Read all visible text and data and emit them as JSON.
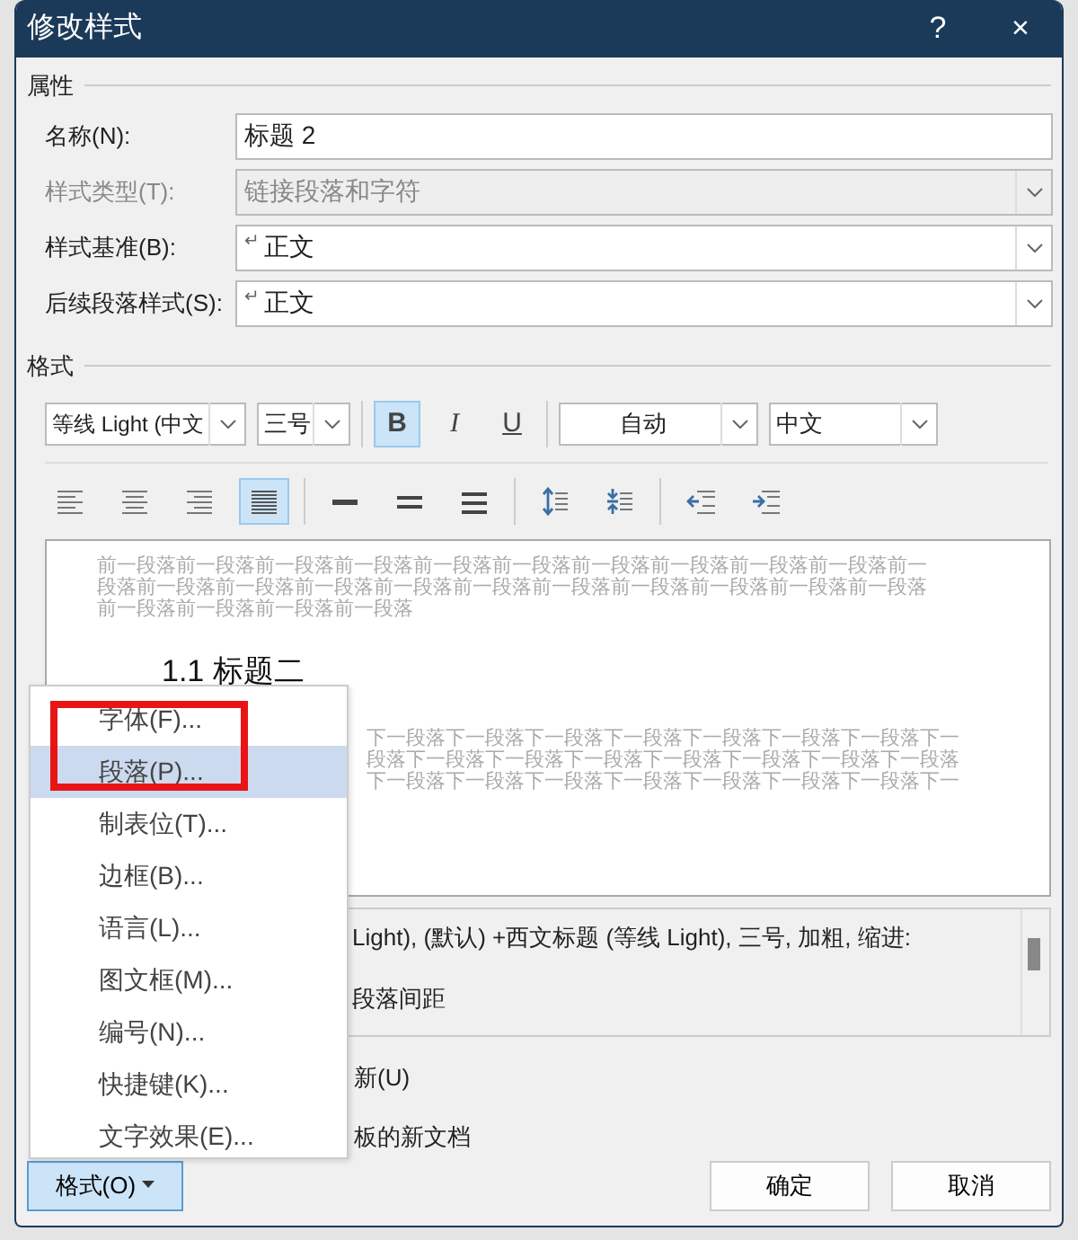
{
  "window": {
    "title": "修改样式",
    "help": "?",
    "close": "×"
  },
  "properties": {
    "heading": "属性",
    "fields": [
      {
        "label": "名称(N):",
        "kind": "text",
        "value": "标题 2",
        "disabled": false
      },
      {
        "label": "样式类型(T):",
        "kind": "combo",
        "value": "链接段落和字符",
        "disabled": true
      },
      {
        "label": "样式基准(B):",
        "kind": "combo",
        "value": "正文",
        "mark": "↵",
        "disabled": false
      },
      {
        "label": "后续段落样式(S):",
        "kind": "combo",
        "value": "正文",
        "mark": "↵",
        "disabled": false
      }
    ]
  },
  "format": {
    "heading": "格式",
    "font": "等线 Light (中文",
    "size": "三号",
    "styles": [
      {
        "kind": "bold",
        "label": "B",
        "selected": true
      },
      {
        "kind": "italic",
        "label": "I",
        "selected": false
      },
      {
        "kind": "underline",
        "label": "U",
        "selected": false
      }
    ],
    "font_color": "自动",
    "language": "中文",
    "paragraph_tools": [
      {
        "kind": "align-left",
        "selected": false
      },
      {
        "kind": "align-center",
        "selected": false
      },
      {
        "kind": "align-right",
        "selected": false
      },
      {
        "kind": "justify",
        "selected": true
      },
      {
        "kind": "sep"
      },
      {
        "kind": "single-spacing",
        "selected": false
      },
      {
        "kind": "one-half-spacing",
        "selected": false
      },
      {
        "kind": "double-spacing",
        "selected": false
      },
      {
        "kind": "sep"
      },
      {
        "kind": "space-increase",
        "selected": false
      },
      {
        "kind": "space-decrease",
        "selected": false
      },
      {
        "kind": "sep"
      },
      {
        "kind": "indent-decrease",
        "selected": false
      },
      {
        "kind": "indent-increase",
        "selected": false
      }
    ]
  },
  "preview": {
    "previous_lines": [
      "前一段落前一段落前一段落前一段落前一段落前一段落前一段落前一段落前一段落前一段落前一",
      "段落前一段落前一段落前一段落前一段落前一段落前一段落前一段落前一段落前一段落前一段落",
      "前一段落前一段落前一段落前一段落"
    ],
    "heading": "1.1 标题二",
    "next_lines": [
      "下一段落下一段落下一段落下一段落下一段落下一段落下一段落下一",
      "段落下一段落下一段落下一段落下一段落下一段落下一段落下一段落",
      "下一段落下一段落下一段落下一段落下一段落下一段落下一段落下一"
    ]
  },
  "description": {
    "lines": [
      "Light), (默认) +西文标题 (等线 Light), 三号, 加粗, 缩进:",
      "段落间距"
    ]
  },
  "options": [
    "新(U)",
    "板的新文档"
  ],
  "menu": {
    "items": [
      {
        "label": "字体(F)...",
        "selected": false,
        "circled": true
      },
      {
        "label": "段落(P)...",
        "selected": true,
        "circled": true
      },
      {
        "label": "制表位(T)...",
        "selected": false,
        "circled": false
      },
      {
        "label": "边框(B)...",
        "selected": false,
        "circled": false
      },
      {
        "label": "语言(L)...",
        "selected": false,
        "circled": false
      },
      {
        "label": "图文框(M)...",
        "selected": false,
        "circled": false
      },
      {
        "label": "编号(N)...",
        "selected": false,
        "circled": false
      },
      {
        "label": "快捷键(K)...",
        "selected": false,
        "circled": false
      },
      {
        "label": "文字效果(E)...",
        "selected": false,
        "circled": false
      }
    ]
  },
  "buttons": {
    "format": {
      "label": "格式(O)",
      "pressed": true
    },
    "ok": "确定",
    "cancel": "取消"
  }
}
